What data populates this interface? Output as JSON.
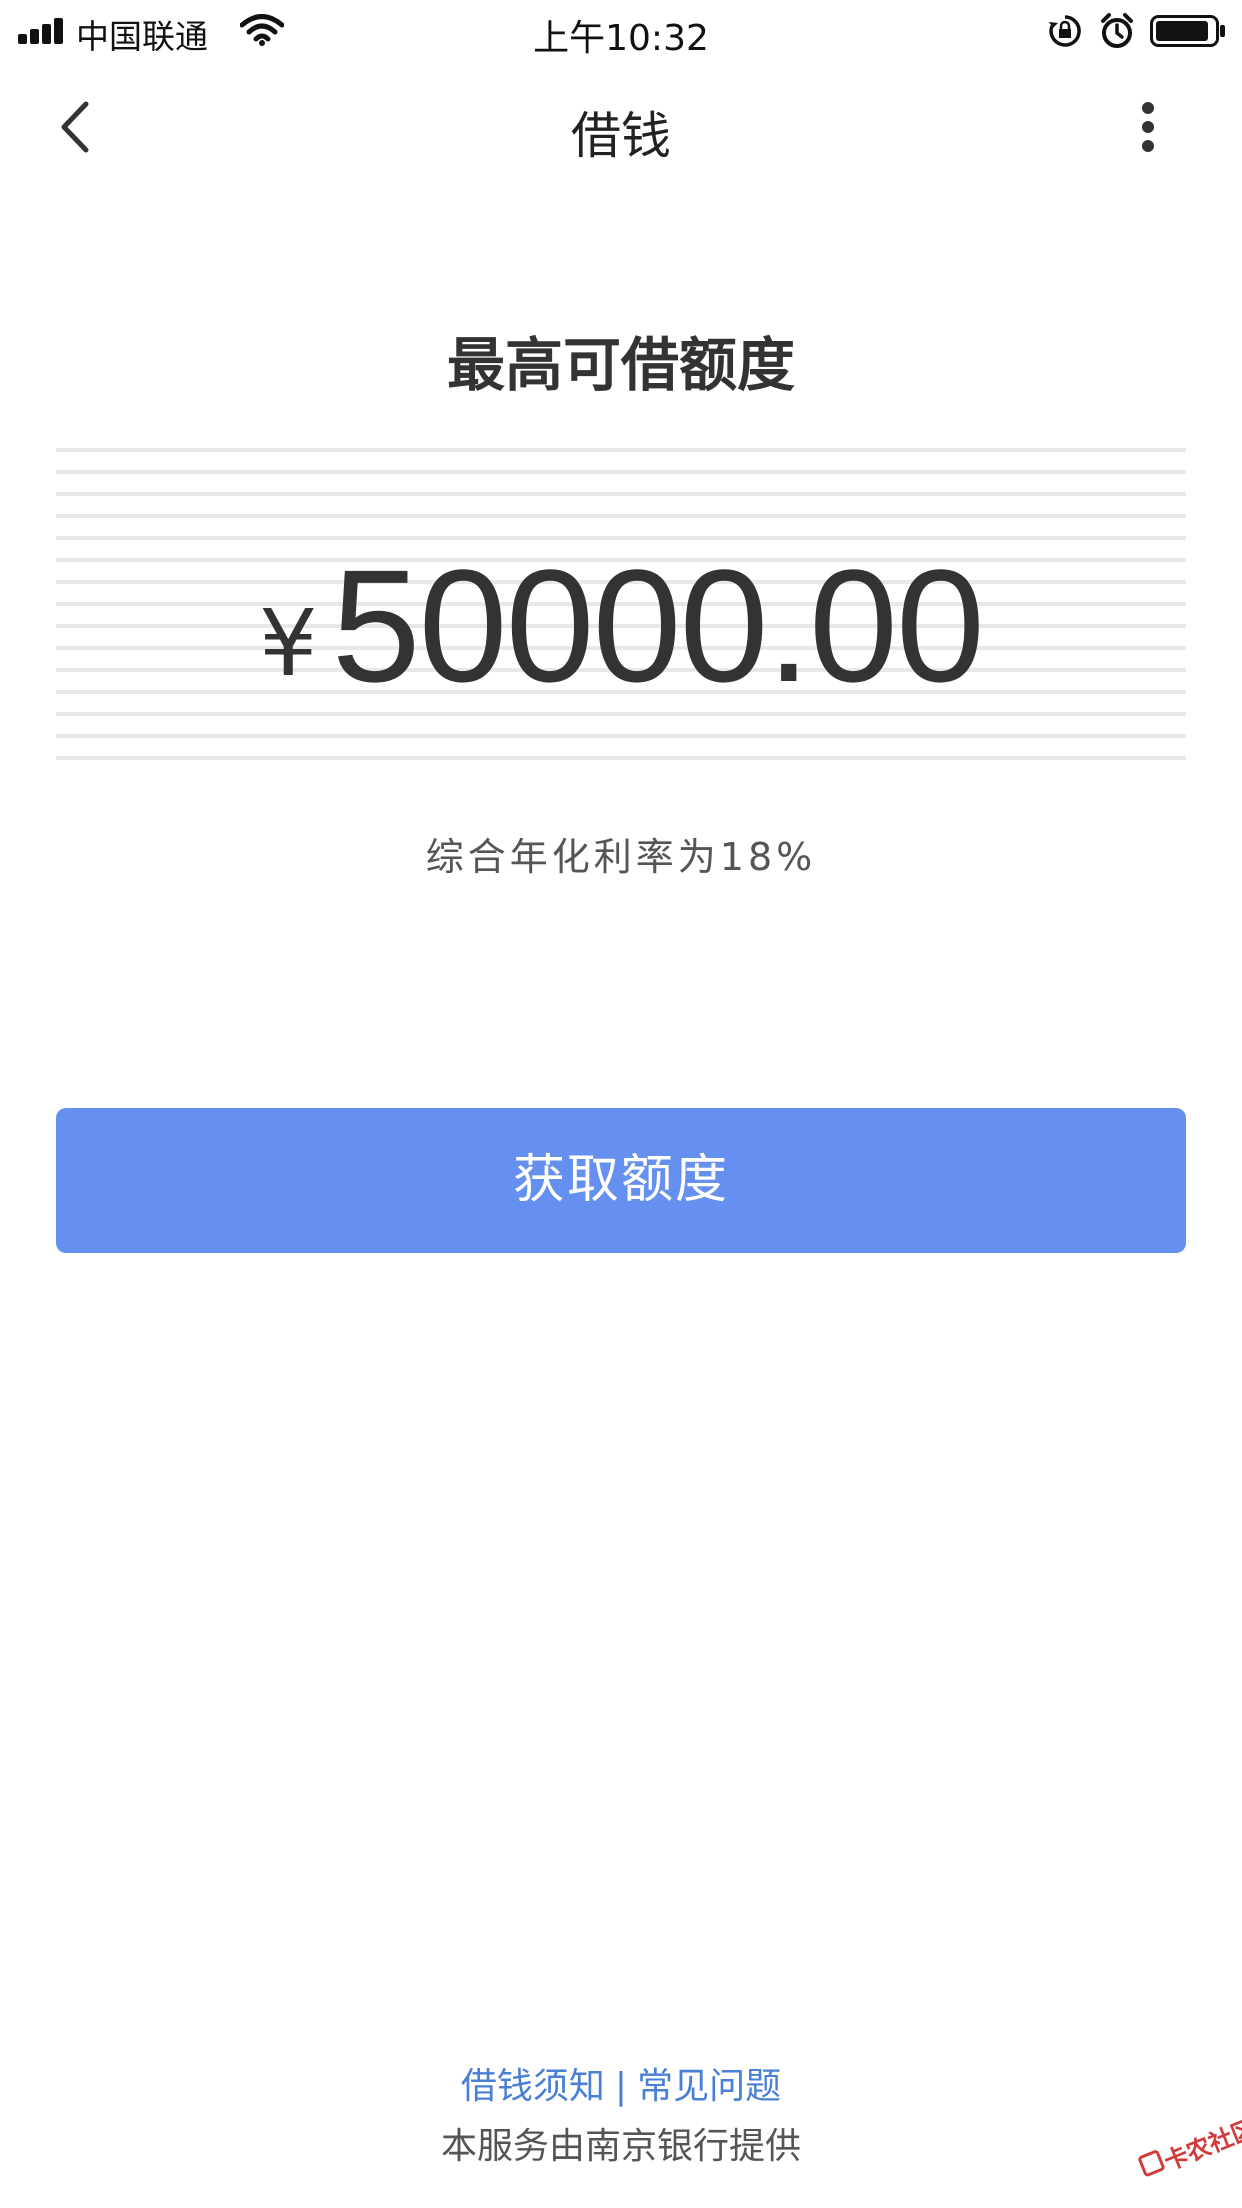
{
  "status_bar": {
    "carrier": "中国联通",
    "time": "上午10:32",
    "icons": [
      "signal-icon",
      "wifi-icon",
      "orientation-lock-icon",
      "alarm-icon",
      "battery-icon"
    ]
  },
  "nav": {
    "title": "借钱",
    "back_icon": "chevron-left-icon",
    "more_icon": "more-vertical-icon"
  },
  "main": {
    "limit_title": "最高可借额度",
    "currency_symbol": "¥",
    "amount": "50000.00",
    "rate_text": "综合年化利率为18%",
    "cta_label": "获取额度"
  },
  "footer": {
    "link_notice": "借钱须知",
    "separator": "|",
    "link_faq": "常见问题",
    "provider": "本服务由南京银行提供"
  },
  "watermark": {
    "text": "卡农社区"
  },
  "colors": {
    "primary": "#6590f0",
    "link": "#4a7fd6",
    "text_dark": "#333333",
    "text_muted": "#555555",
    "watermark": "#d23b3b"
  }
}
